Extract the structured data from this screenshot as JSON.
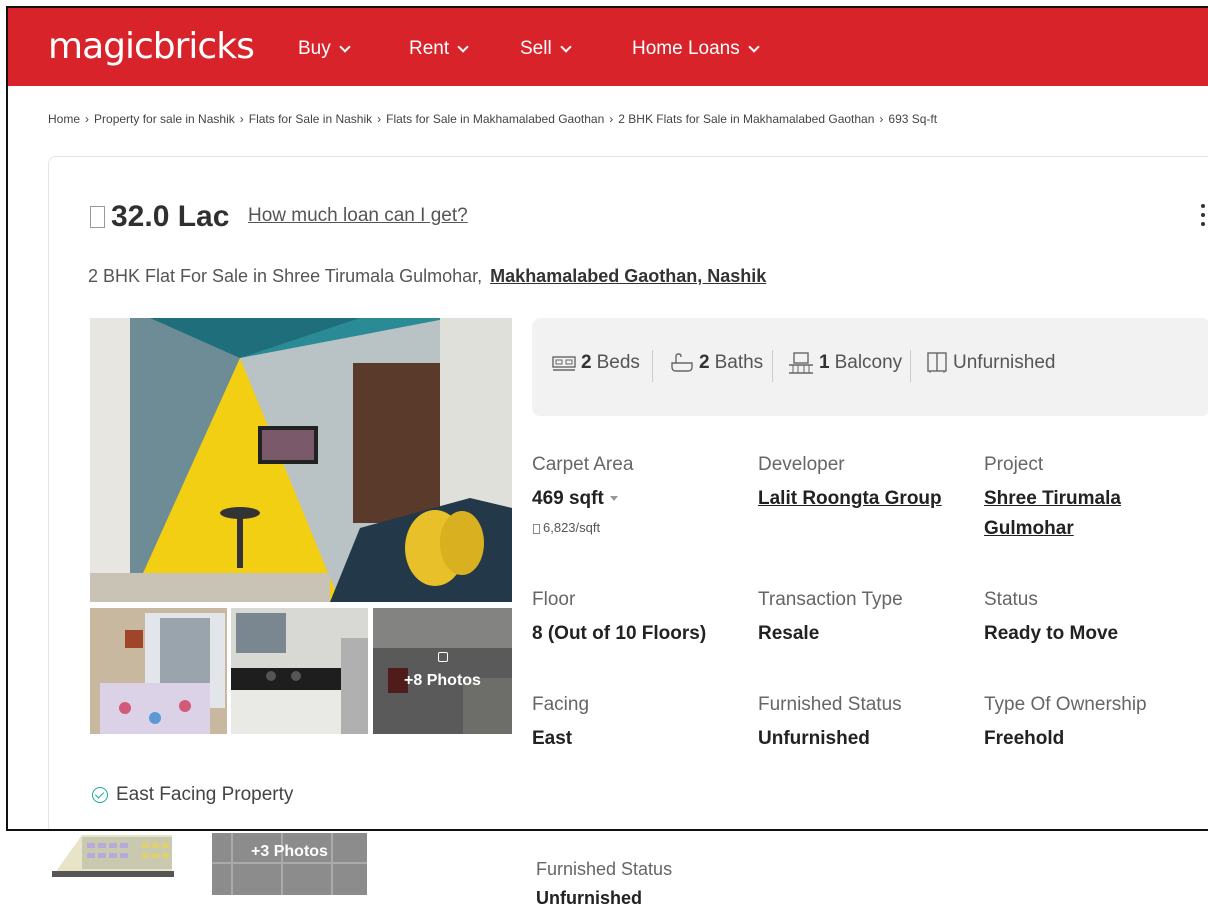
{
  "brand": {
    "logo": "magicbricks",
    "color": "#d8232a"
  },
  "nav": [
    {
      "label": "Buy"
    },
    {
      "label": "Rent"
    },
    {
      "label": "Sell"
    },
    {
      "label": "Home Loans"
    }
  ],
  "breadcrumb": [
    "Home",
    "Property for sale in Nashik",
    "Flats for Sale in Nashik",
    "Flats for Sale in Makhamalabed Gaothan",
    "2 BHK Flats for Sale in Makhamalabed Gaothan",
    "693 Sq-ft"
  ],
  "listing": {
    "price": "32.0 Lac",
    "loan_link": "How much loan can I get?",
    "title": "2 BHK Flat For Sale in Shree Tirumala Gulmohar,",
    "location": "Makhamalabed Gaothan, Nashik",
    "photos_more": "+8 Photos",
    "facilities": {
      "beds_count": "2",
      "beds_label": "Beds",
      "baths_count": "2",
      "baths_label": "Baths",
      "balcony_count": "1",
      "balcony_label": "Balcony",
      "furnishing": "Unfurnished"
    },
    "attributes": {
      "carpet_area_label": "Carpet Area",
      "carpet_area_value": "469 sqft",
      "price_per_sqft": "6,823/sqft",
      "developer_label": "Developer",
      "developer_value": "Lalit Roongta Group",
      "project_label": "Project",
      "project_value_1": "Shree Tirumala",
      "project_value_2": "Gulmohar",
      "floor_label": "Floor",
      "floor_value": "8 (Out of 10 Floors)",
      "transaction_label": "Transaction Type",
      "transaction_value": "Resale",
      "status_label": "Status",
      "status_value": "Ready to Move",
      "facing_label": "Facing",
      "facing_value": "East",
      "furnished_label": "Furnished Status",
      "furnished_value": "Unfurnished",
      "ownership_label": "Type Of Ownership",
      "ownership_value": "Freehold"
    },
    "feature_tag": "East Facing Property"
  },
  "below_fold": {
    "photos_more": "+3 Photos",
    "furnished_label": "Furnished Status",
    "furnished_value": "Unfurnished"
  }
}
